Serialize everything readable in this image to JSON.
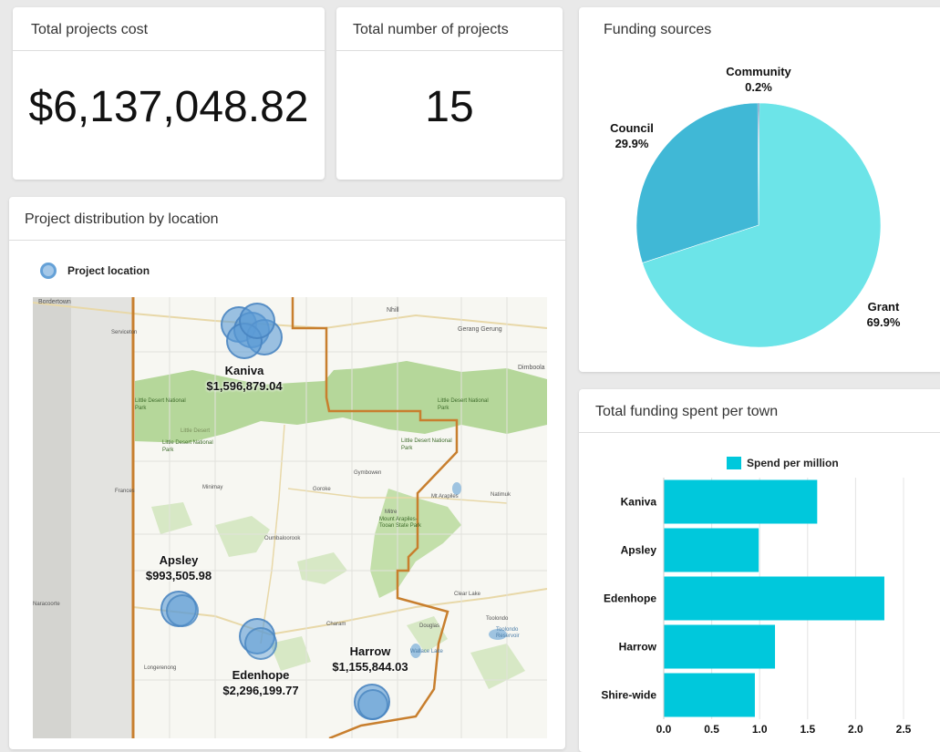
{
  "cards": {
    "total_cost": {
      "title": "Total projects cost",
      "value": "$6,137,048.82"
    },
    "total_projects": {
      "title": "Total number of projects",
      "value": "15"
    },
    "funding_sources": {
      "title": "Funding sources"
    },
    "distribution": {
      "title": "Project distribution by location",
      "legend_label": "Project location"
    },
    "town_spend": {
      "title": "Total funding spent per town",
      "legend_label": "Spend per million"
    }
  },
  "map": {
    "places": [
      {
        "name": "Kaniva",
        "amount": "$1,596,879.04"
      },
      {
        "name": "Apsley",
        "amount": "$993,505.98"
      },
      {
        "name": "Edenhope",
        "amount": "$2,296,199.77"
      },
      {
        "name": "Harrow",
        "amount": "$1,155,844.03"
      }
    ],
    "map_labels": {
      "bordertown": "Bordertown",
      "nhill": "Nhill",
      "geringgering": "Gerang Gerung",
      "dimboola": "Dimboola",
      "serviceton": "Serviceton",
      "little_desert_np_1": "Little Desert National Park",
      "little_desert": "Little Desert",
      "little_desert_np_2": "Little Desert National Park",
      "little_desert_np_3": "Little Desert National Park",
      "little_desert_np_4": "Little Desert National Park",
      "frances": "Frances",
      "minimay": "Minimay",
      "goroke": "Goroke",
      "gymbowen": "Gymbowen",
      "mt_arapiles": "Mt Arapiles",
      "natimuk": "Natimuk",
      "mitre": "Mitre",
      "mount_arapiles_park": "Mount Arapiles-Tooan State Park",
      "oumbaloorook": "Oumbaloorook",
      "naracoorte": "Naracoorte",
      "charam": "Charam",
      "clear_lake": "Clear Lake",
      "longerenong": "Longerenong",
      "douglas": "Douglas",
      "toolondo": "Toolondo",
      "toolondo_reservoir": "Toolondo Reservoir",
      "wallace_lake": "Wallace Lake"
    },
    "colors": {
      "bubble": "#5b9bd5",
      "border_line": "#c87f2e",
      "park": "#b5d79a"
    }
  },
  "chart_data": [
    {
      "type": "pie",
      "title": "Funding sources",
      "series": [
        {
          "name": "Grant",
          "values": [
            69.9
          ]
        },
        {
          "name": "Council",
          "values": [
            29.9
          ]
        },
        {
          "name": "Community",
          "values": [
            0.2
          ]
        }
      ],
      "slices": [
        {
          "label": "Grant",
          "value": 69.9,
          "display": "69.9%",
          "color": "#6ce4e8"
        },
        {
          "label": "Council",
          "value": 29.9,
          "display": "29.9%",
          "color": "#40b8d6"
        },
        {
          "label": "Community",
          "value": 0.2,
          "display": "0.2%",
          "color": "#2a6fa8"
        }
      ]
    },
    {
      "type": "bar",
      "orientation": "horizontal",
      "title": "Total funding spent per town",
      "categories": [
        "Kaniva",
        "Apsley",
        "Edenhope",
        "Harrow",
        "Shire-wide"
      ],
      "series": [
        {
          "name": "Spend per million",
          "values": [
            1.6,
            0.99,
            2.3,
            1.16,
            0.95
          ]
        }
      ],
      "xlim": [
        0,
        2.5
      ],
      "xticks": [
        "0.0",
        "0.5",
        "1.0",
        "1.5",
        "2.0",
        "2.5"
      ],
      "grid": true,
      "legend": "top",
      "color": "#00c8dc"
    }
  ]
}
